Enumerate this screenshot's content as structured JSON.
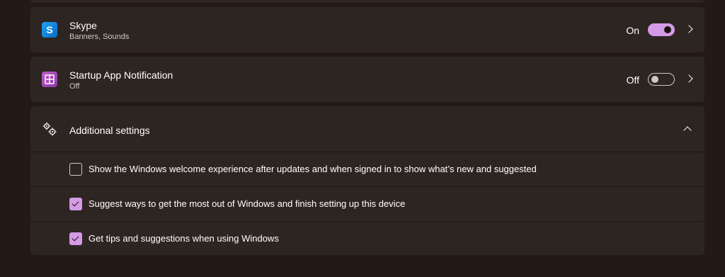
{
  "notifications": [
    {
      "name": "Skype",
      "detail": "Banners, Sounds",
      "state_label": "On",
      "enabled": true,
      "icon": "skype-icon",
      "icon_glyph": "S"
    },
    {
      "name": "Startup App Notification",
      "detail": "Off",
      "state_label": "Off",
      "enabled": false,
      "icon": "startup-app-icon"
    }
  ],
  "additional_settings": {
    "title": "Additional settings",
    "icon": "gear-icon",
    "expanded": true,
    "options": [
      {
        "label": "Show the Windows welcome experience after updates and when signed in to show what’s new and suggested",
        "checked": false
      },
      {
        "label": "Suggest ways to get the most out of Windows and finish setting up this device",
        "checked": true
      },
      {
        "label": "Get tips and suggestions when using Windows",
        "checked": true
      }
    ]
  },
  "colors": {
    "background": "#231a17",
    "card": "#2d2522",
    "accent": "#d59ae6"
  }
}
